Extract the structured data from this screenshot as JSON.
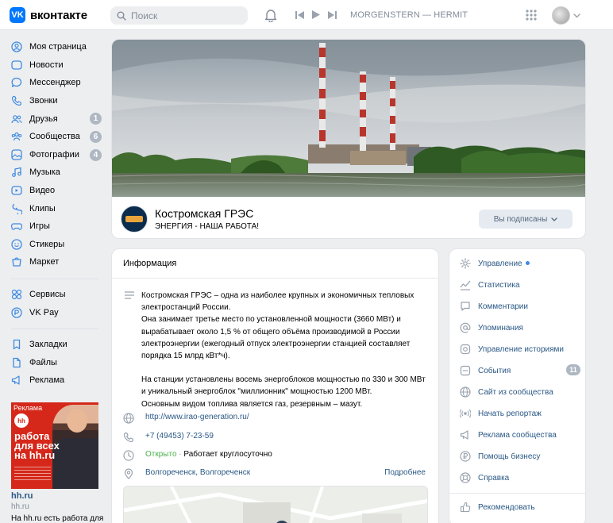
{
  "header": {
    "logo_text": "вконтакте",
    "logo_mark": "VK",
    "search_placeholder": "Поиск",
    "track": "MORGENSTERN — HERMIT",
    "icons": [
      "vk-logo-icon",
      "search-icon",
      "bell-icon",
      "prev-track-icon",
      "play-icon",
      "next-track-icon",
      "apps-grid-icon",
      "chevron-down-icon"
    ]
  },
  "sidebar": {
    "items": [
      {
        "label": "Моя страница",
        "icon": "user-icon"
      },
      {
        "label": "Новости",
        "icon": "news-icon"
      },
      {
        "label": "Мессенджер",
        "icon": "message-icon"
      },
      {
        "label": "Звонки",
        "icon": "phone-icon"
      },
      {
        "label": "Друзья",
        "icon": "friends-icon",
        "badge": "1"
      },
      {
        "label": "Сообщества",
        "icon": "groups-icon",
        "badge": "6"
      },
      {
        "label": "Фотографии",
        "icon": "photo-icon",
        "badge": "4"
      },
      {
        "label": "Музыка",
        "icon": "music-icon"
      },
      {
        "label": "Видео",
        "icon": "video-icon"
      },
      {
        "label": "Клипы",
        "icon": "clips-icon"
      },
      {
        "label": "Игры",
        "icon": "games-icon"
      },
      {
        "label": "Стикеры",
        "icon": "stickers-icon"
      },
      {
        "label": "Маркет",
        "icon": "market-icon"
      }
    ],
    "items2": [
      {
        "label": "Сервисы",
        "icon": "services-icon"
      },
      {
        "label": "VK Pay",
        "icon": "vkpay-icon"
      }
    ],
    "items3": [
      {
        "label": "Закладки",
        "icon": "bookmarks-icon"
      },
      {
        "label": "Файлы",
        "icon": "files-icon"
      },
      {
        "label": "Реклама",
        "icon": "ads-icon"
      }
    ]
  },
  "ad": {
    "label": "Реклама",
    "logo": "hh",
    "headline": "работа для всех на hh.ru",
    "name": "hh.ru",
    "domain": "hh.ru",
    "text": "На hh.ru есть работа для"
  },
  "group": {
    "name": "Костромская ГРЭС",
    "status": "ЭНЕРГИЯ - НАША РАБОТА!",
    "subscribe_label": "Вы подписаны"
  },
  "info": {
    "title": "Информация",
    "description": [
      "Костромская ГРЭС – одна из наиболее крупных и экономичных тепловых электростанций России.",
      "Она занимает третье место по установленной мощности (3660 МВт) и вырабатывает около 1,5 % от общего объёма производимой в России электроэнергии (ежегодный отпуск электроэнергии станцией составляет порядка 15 млрд кВт*ч).",
      "На станции установлены восемь энергоблоков мощностью по 330 и 300 МВт и уникальный энергоблок \"миллионник\" мощностью 1200 МВт.",
      "Основным видом топлива является газ, резервным – мазут."
    ],
    "website": "http://www.irao-generation.ru/",
    "phone": "+7 (49453) 7-23-59",
    "open_status": "Открыто",
    "hours_separator": " · ",
    "hours": "Работает круглосуточно",
    "address": "Волгореченск, Волгореченск",
    "more_label": "Подробнее"
  },
  "menu": {
    "items": [
      {
        "label": "Управление",
        "icon": "gear-icon",
        "dot": true
      },
      {
        "label": "Статистика",
        "icon": "stats-icon"
      },
      {
        "label": "Комментарии",
        "icon": "comment-icon"
      },
      {
        "label": "Упоминания",
        "icon": "mention-icon"
      },
      {
        "label": "Управление историями",
        "icon": "stories-icon"
      },
      {
        "label": "События",
        "icon": "events-icon",
        "badge": "11"
      },
      {
        "label": "Сайт из сообщества",
        "icon": "globe-icon"
      },
      {
        "label": "Начать репортаж",
        "icon": "live-icon"
      },
      {
        "label": "Реклама сообщества",
        "icon": "megaphone-icon"
      },
      {
        "label": "Помощь бизнесу",
        "icon": "business-icon"
      },
      {
        "label": "Справка",
        "icon": "help-icon"
      },
      {
        "label": "Рекомендовать",
        "icon": "like-icon"
      }
    ]
  },
  "colors": {
    "accent": "#0077ff",
    "link": "#2a5885",
    "open": "#4bb34b",
    "badge": "#aeb7c2"
  }
}
